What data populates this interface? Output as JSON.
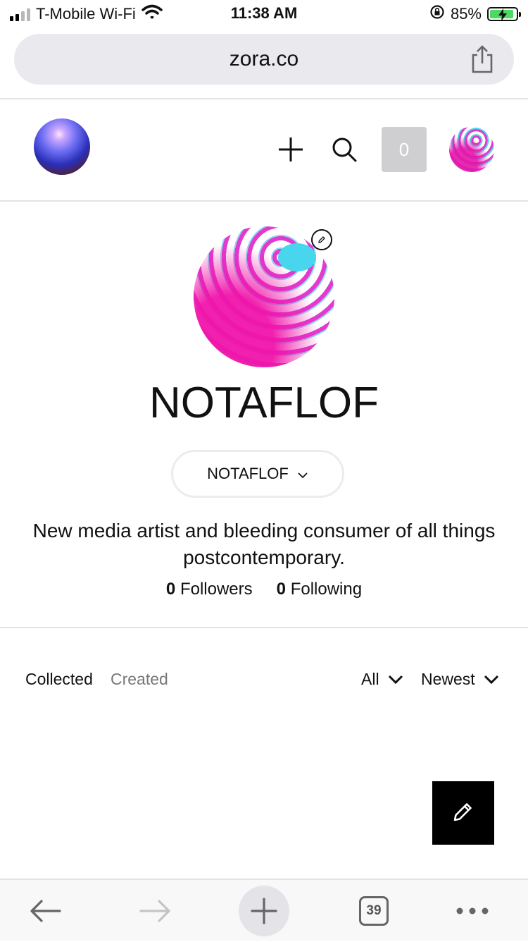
{
  "status_bar": {
    "carrier": "T-Mobile Wi-Fi",
    "time": "11:38 AM",
    "battery": "85%",
    "icons": [
      "signal-icon",
      "wifi-icon",
      "orientation-lock-icon",
      "battery-charging-icon"
    ]
  },
  "browser": {
    "url": "zora.co",
    "tab_count": "39",
    "icons": [
      "share-icon",
      "back-icon",
      "forward-icon",
      "new-tab-icon",
      "tabs-icon",
      "more-icon"
    ]
  },
  "header": {
    "notification_count": "0",
    "icons": [
      "logo-icon",
      "plus-icon",
      "search-icon",
      "avatar"
    ]
  },
  "profile": {
    "name": "NOTAFLOF",
    "account_dropdown": "NOTAFLOF",
    "bio": "New media artist and bleeding consumer of all things postcontemporary.",
    "followers_count": "0",
    "followers_label": "Followers",
    "following_count": "0",
    "following_label": "Following"
  },
  "tabs": {
    "collected": "Collected",
    "created": "Created",
    "active": "Collected"
  },
  "filters": {
    "type": "All",
    "sort": "Newest"
  },
  "colors": {
    "accent": "#000000",
    "badge_bg": "#cfcfd2",
    "url_bar_bg": "#e9e9ee",
    "battery_fill": "#4cd964",
    "inactive_tab": "#777777"
  }
}
